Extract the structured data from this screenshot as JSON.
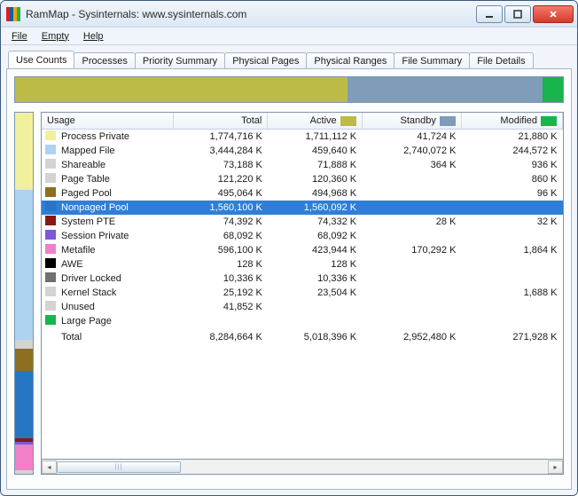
{
  "window": {
    "title": "RamMap - Sysinternals: www.sysinternals.com"
  },
  "menubar": [
    "File",
    "Empty",
    "Help"
  ],
  "tabs": [
    "Use Counts",
    "Processes",
    "Priority Summary",
    "Physical Pages",
    "Physical Ranges",
    "File Summary",
    "File Details"
  ],
  "activeTabIndex": 0,
  "columns": {
    "usage": "Usage",
    "total": "Total",
    "active": "Active",
    "standby": "Standby",
    "modified": "Modified"
  },
  "colors": {
    "active_swatch": "#bcbb48",
    "standby_swatch": "#7f9cb9",
    "modified_swatch": "#17b54b"
  },
  "rows": [
    {
      "color": "#f2f09c",
      "usage": "Process Private",
      "total": "1,774,716 K",
      "active": "1,711,112 K",
      "standby": "41,724 K",
      "modified": "21,880 K"
    },
    {
      "color": "#aed3f1",
      "usage": "Mapped File",
      "total": "3,444,284 K",
      "active": "459,640 K",
      "standby": "2,740,072 K",
      "modified": "244,572 K"
    },
    {
      "color": "#d3d3d3",
      "usage": "Shareable",
      "total": "73,188 K",
      "active": "71,888 K",
      "standby": "364 K",
      "modified": "936 K"
    },
    {
      "color": "#d3d3d3",
      "usage": "Page Table",
      "total": "121,220 K",
      "active": "120,360 K",
      "standby": "",
      "modified": "860 K"
    },
    {
      "color": "#8c6f1f",
      "usage": "Paged Pool",
      "total": "495,064 K",
      "active": "494,968 K",
      "standby": "",
      "modified": "96 K"
    },
    {
      "color": "#2776c4",
      "usage": "Nonpaged Pool",
      "total": "1,560,100 K",
      "active": "1,560,092 K",
      "standby": "",
      "modified": "",
      "selected": true
    },
    {
      "color": "#8a1717",
      "usage": "System PTE",
      "total": "74,392 K",
      "active": "74,332 K",
      "standby": "28 K",
      "modified": "32 K"
    },
    {
      "color": "#7b59d9",
      "usage": "Session Private",
      "total": "68,092 K",
      "active": "68,092 K",
      "standby": "",
      "modified": ""
    },
    {
      "color": "#f180c8",
      "usage": "Metafile",
      "total": "596,100 K",
      "active": "423,944 K",
      "standby": "170,292 K",
      "modified": "1,864 K"
    },
    {
      "color": "#000000",
      "usage": "AWE",
      "total": "128 K",
      "active": "128 K",
      "standby": "",
      "modified": ""
    },
    {
      "color": "#6f6f6f",
      "usage": "Driver Locked",
      "total": "10,336 K",
      "active": "10,336 K",
      "standby": "",
      "modified": ""
    },
    {
      "color": "#d3d3d3",
      "usage": "Kernel Stack",
      "total": "25,192 K",
      "active": "23,504 K",
      "standby": "",
      "modified": "1,688 K"
    },
    {
      "color": "#d3d3d3",
      "usage": "Unused",
      "total": "41,852 K",
      "active": "",
      "standby": "",
      "modified": ""
    },
    {
      "color": "#17b54b",
      "usage": "Large Page",
      "total": "",
      "active": "",
      "standby": "",
      "modified": ""
    }
  ],
  "totals": {
    "label": "Total",
    "total": "8,284,664 K",
    "active": "5,018,396 K",
    "standby": "2,952,480 K",
    "modified": "271,928 K"
  },
  "chart_data": {
    "type": "table",
    "title": "RamMap Use Counts",
    "columns": [
      "Usage",
      "Total",
      "Active",
      "Standby",
      "Modified"
    ],
    "series": [
      {
        "name": "Process Private",
        "values": [
          1774716,
          1711112,
          41724,
          21880
        ]
      },
      {
        "name": "Mapped File",
        "values": [
          3444284,
          459640,
          2740072,
          244572
        ]
      },
      {
        "name": "Shareable",
        "values": [
          73188,
          71888,
          364,
          936
        ]
      },
      {
        "name": "Page Table",
        "values": [
          121220,
          120360,
          null,
          860
        ]
      },
      {
        "name": "Paged Pool",
        "values": [
          495064,
          494968,
          null,
          96
        ]
      },
      {
        "name": "Nonpaged Pool",
        "values": [
          1560100,
          1560092,
          null,
          null
        ]
      },
      {
        "name": "System PTE",
        "values": [
          74392,
          74332,
          28,
          32
        ]
      },
      {
        "name": "Session Private",
        "values": [
          68092,
          68092,
          null,
          null
        ]
      },
      {
        "name": "Metafile",
        "values": [
          596100,
          423944,
          170292,
          1864
        ]
      },
      {
        "name": "AWE",
        "values": [
          128,
          128,
          null,
          null
        ]
      },
      {
        "name": "Driver Locked",
        "values": [
          10336,
          10336,
          null,
          null
        ]
      },
      {
        "name": "Kernel Stack",
        "values": [
          25192,
          23504,
          null,
          1688
        ]
      },
      {
        "name": "Unused",
        "values": [
          41852,
          null,
          null,
          null
        ]
      },
      {
        "name": "Large Page",
        "values": [
          null,
          null,
          null,
          null
        ]
      }
    ],
    "totals": [
      8284664,
      5018396,
      2952480,
      271928
    ],
    "unit": "K"
  }
}
